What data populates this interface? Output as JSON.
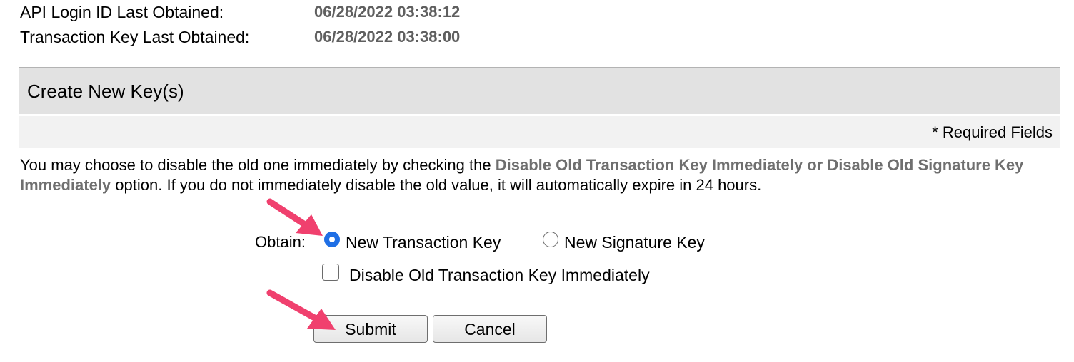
{
  "info": {
    "api_login_label": "API Login ID Last Obtained:",
    "api_login_value": "06/28/2022 03:38:12",
    "transaction_key_label": "Transaction Key Last Obtained:",
    "transaction_key_value": "06/28/2022 03:38:00"
  },
  "section": {
    "title": "Create New Key(s)",
    "required_note": "* Required Fields"
  },
  "description": {
    "part1": "You may choose to disable the old one immediately by checking the ",
    "highlight": "Disable Old Transaction Key Immediately or Disable Old Signature Key Immediately",
    "part2": " option. If you do not immediately disable the old value, it will automatically expire in 24 hours."
  },
  "form": {
    "obtain_label": "Obtain:",
    "options": [
      {
        "label": "New Transaction Key",
        "selected": true
      },
      {
        "label": "New Signature Key",
        "selected": false
      }
    ],
    "disable_checkbox_label": "Disable Old Transaction Key Immediately",
    "disable_checkbox_checked": false,
    "submit_label": "Submit",
    "cancel_label": "Cancel"
  },
  "colors": {
    "annotation_arrow": "#f0406e",
    "radio_selected": "#1f6fe5",
    "header_bg": "#e2e2e2"
  }
}
